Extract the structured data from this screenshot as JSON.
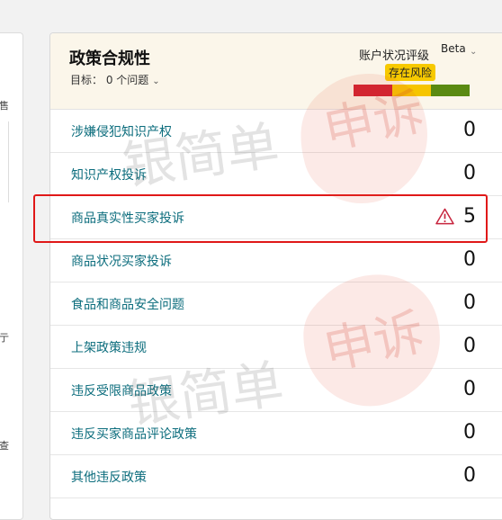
{
  "left_panel": {
    "fragments": [
      "售",
      "亍",
      "查"
    ]
  },
  "card": {
    "title": "政策合规性",
    "goal": "目标： 0 个问题",
    "account_health": {
      "label": "账户状况评级",
      "beta": "Beta",
      "status": "存在风险",
      "meter_colors": [
        "#d01f2f",
        "#f6c500",
        "#5a8a12"
      ]
    },
    "rows": [
      {
        "label": "涉嫌侵犯知识产权",
        "value": "0",
        "warning": false
      },
      {
        "label": "知识产权投诉",
        "value": "0",
        "warning": false
      },
      {
        "label": "商品真实性买家投诉",
        "value": "5",
        "warning": true
      },
      {
        "label": "商品状况买家投诉",
        "value": "0",
        "warning": false
      },
      {
        "label": "食品和商品安全问题",
        "value": "0",
        "warning": false
      },
      {
        "label": "上架政策违规",
        "value": "0",
        "warning": false
      },
      {
        "label": "违反受限商品政策",
        "value": "0",
        "warning": false
      },
      {
        "label": "违反买家商品评论政策",
        "value": "0",
        "warning": false
      },
      {
        "label": "其他违反政策",
        "value": "0",
        "warning": false
      }
    ]
  },
  "annotation_color": "#e01818",
  "watermark": {
    "text_1": "银简单",
    "text_2": "申诉",
    "text_3": "银简单",
    "text_4": "申诉"
  }
}
